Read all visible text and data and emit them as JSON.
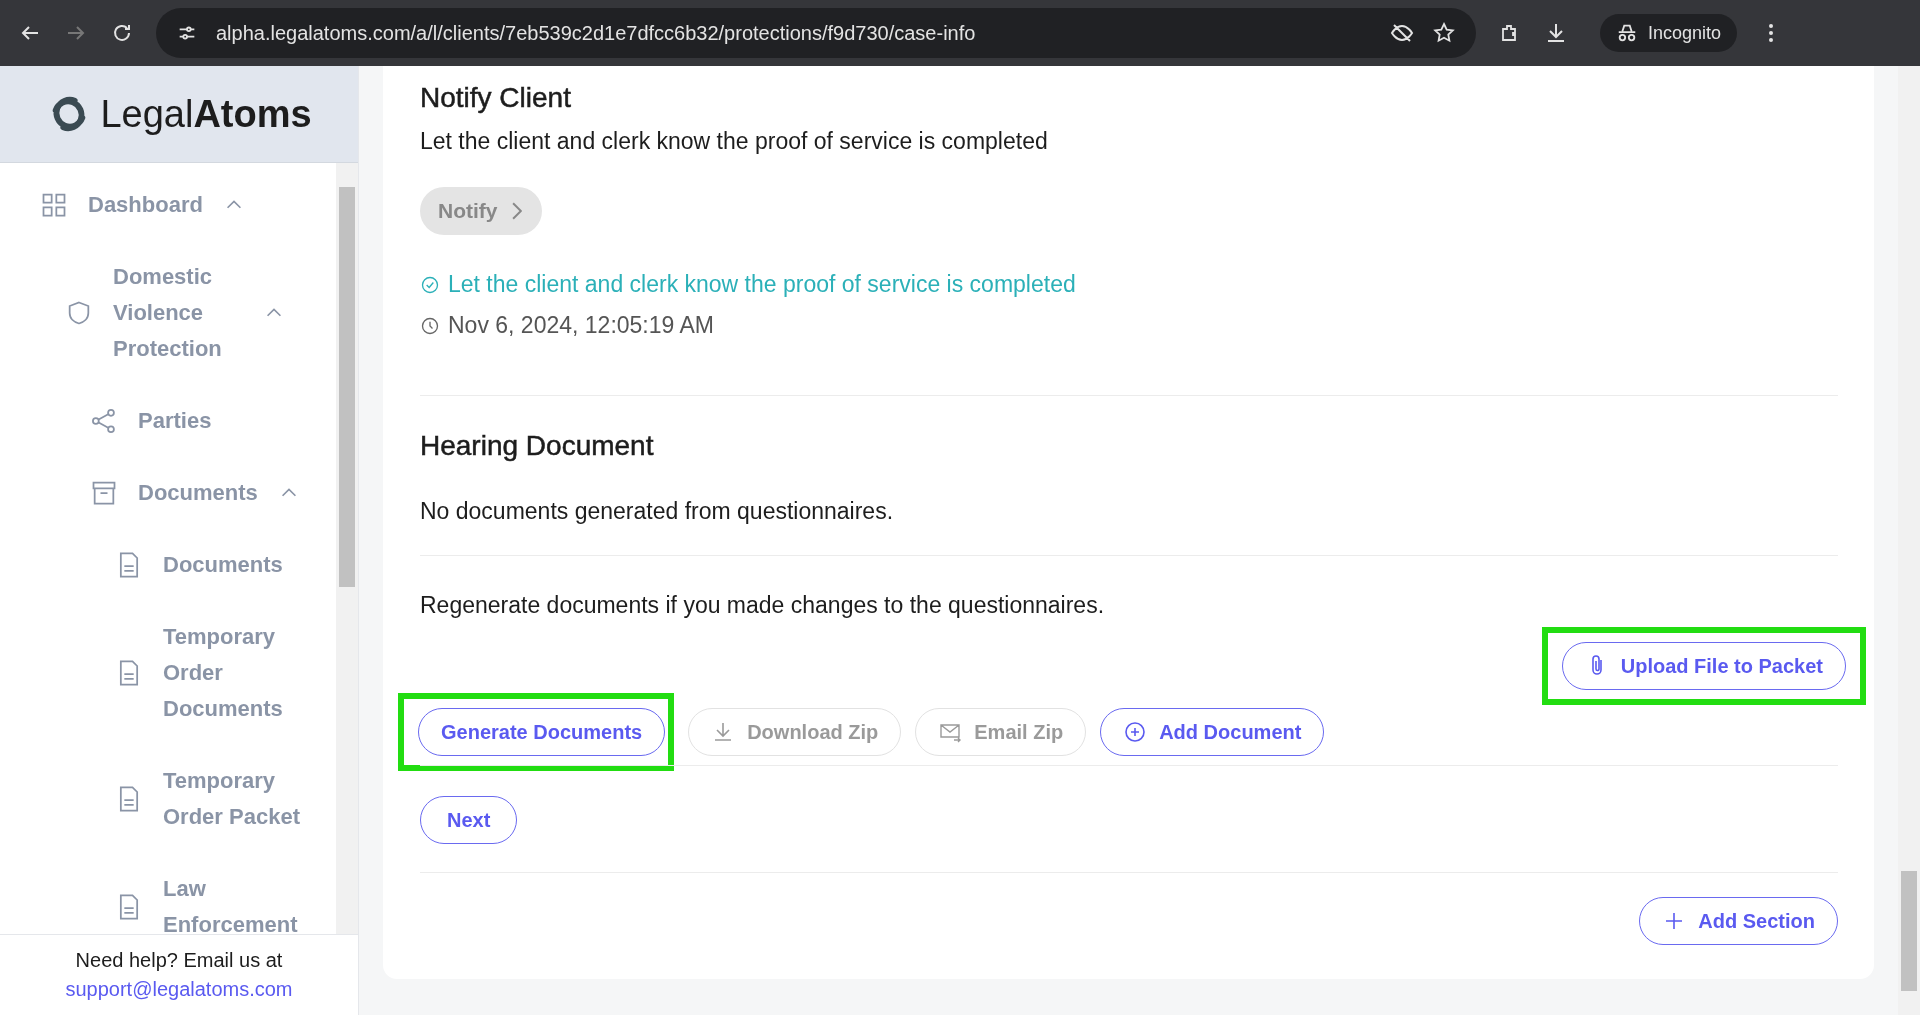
{
  "browser": {
    "url": "alpha.legalatoms.com/a/l/clients/7eb539c2d1e7dfcc6b32/protections/f9d730/case-info",
    "profile": "Incognito"
  },
  "sidebar": {
    "logo": "Legal**Atoms**",
    "nav": [
      {
        "label": "Dashboard",
        "kind": "grid",
        "expanded": true,
        "children": [
          {
            "label": "Domestic Violence Protection",
            "kind": "shield",
            "expanded": true,
            "children": [
              {
                "label": "Parties",
                "kind": "share"
              },
              {
                "label": "Documents",
                "kind": "archive",
                "expanded": true,
                "children": [
                  {
                    "label": "Documents",
                    "kind": "file"
                  },
                  {
                    "label": "Temporary Order Documents",
                    "kind": "file"
                  },
                  {
                    "label": "Temporary Order Packet",
                    "kind": "file"
                  },
                  {
                    "label": "Law Enforcement",
                    "kind": "file"
                  }
                ]
              }
            ]
          }
        ]
      }
    ],
    "help": {
      "text": "Need help? Email us at",
      "email": "support@legalatoms.com"
    }
  },
  "notify": {
    "title": "Notify Client",
    "description": "Let the client and clerk know the proof of service is completed",
    "button": {
      "label": "Notify",
      "disabled": true
    },
    "status": "Let the client and clerk know the proof of service is completed",
    "timestamp": "Nov 6, 2024, 12:05:19 AM"
  },
  "hearing": {
    "title": "Hearing Document",
    "empty_message": "No documents generated from questionnaires.",
    "regen_message": "Regenerate documents if you made changes to the questionnaires.",
    "upload": {
      "label": "Upload File to Packet",
      "kind": "clip",
      "disabled": false,
      "highlighted": true
    },
    "buttons": [
      {
        "label": "Generate Documents",
        "kind": "none",
        "disabled": false,
        "highlighted": true
      },
      {
        "label": "Download Zip",
        "kind": "download",
        "disabled": true,
        "highlighted": false
      },
      {
        "label": "Email Zip",
        "kind": "email",
        "disabled": true,
        "highlighted": false
      },
      {
        "label": "Add Document",
        "kind": "add",
        "disabled": false,
        "highlighted": false
      }
    ],
    "next": "Next"
  },
  "add_section": "Add Section"
}
